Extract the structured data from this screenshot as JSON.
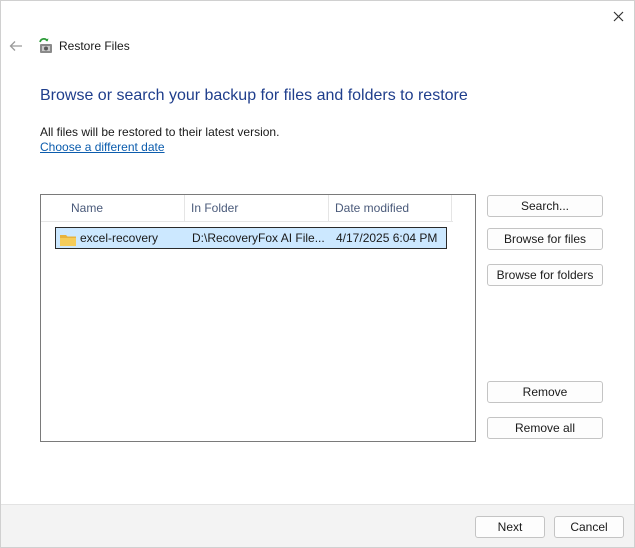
{
  "window": {
    "title": "Restore Files"
  },
  "icons": {
    "back": "back-arrow-icon",
    "close": "close-icon",
    "app": "restore-files-icon",
    "folder": "folder-icon"
  },
  "main": {
    "heading": "Browse or search your backup for files and folders to restore",
    "info": "All files will be restored to their latest version.",
    "link": "Choose a different date"
  },
  "file_list": {
    "columns": [
      "Name",
      "In Folder",
      "Date modified"
    ],
    "rows": [
      {
        "name": "excel-recovery",
        "folder": "D:\\RecoveryFox AI File...",
        "date": "4/17/2025 6:04 PM"
      }
    ]
  },
  "side_buttons": {
    "search": "Search...",
    "browse_files": "Browse for files",
    "browse_folders": "Browse for folders",
    "remove": "Remove",
    "remove_all": "Remove all"
  },
  "footer": {
    "next": "Next",
    "cancel": "Cancel"
  },
  "colors": {
    "heading": "#1f3e8c",
    "link": "#0b5cad",
    "selection": "#cce8ff",
    "folder": "#f2c94c"
  }
}
